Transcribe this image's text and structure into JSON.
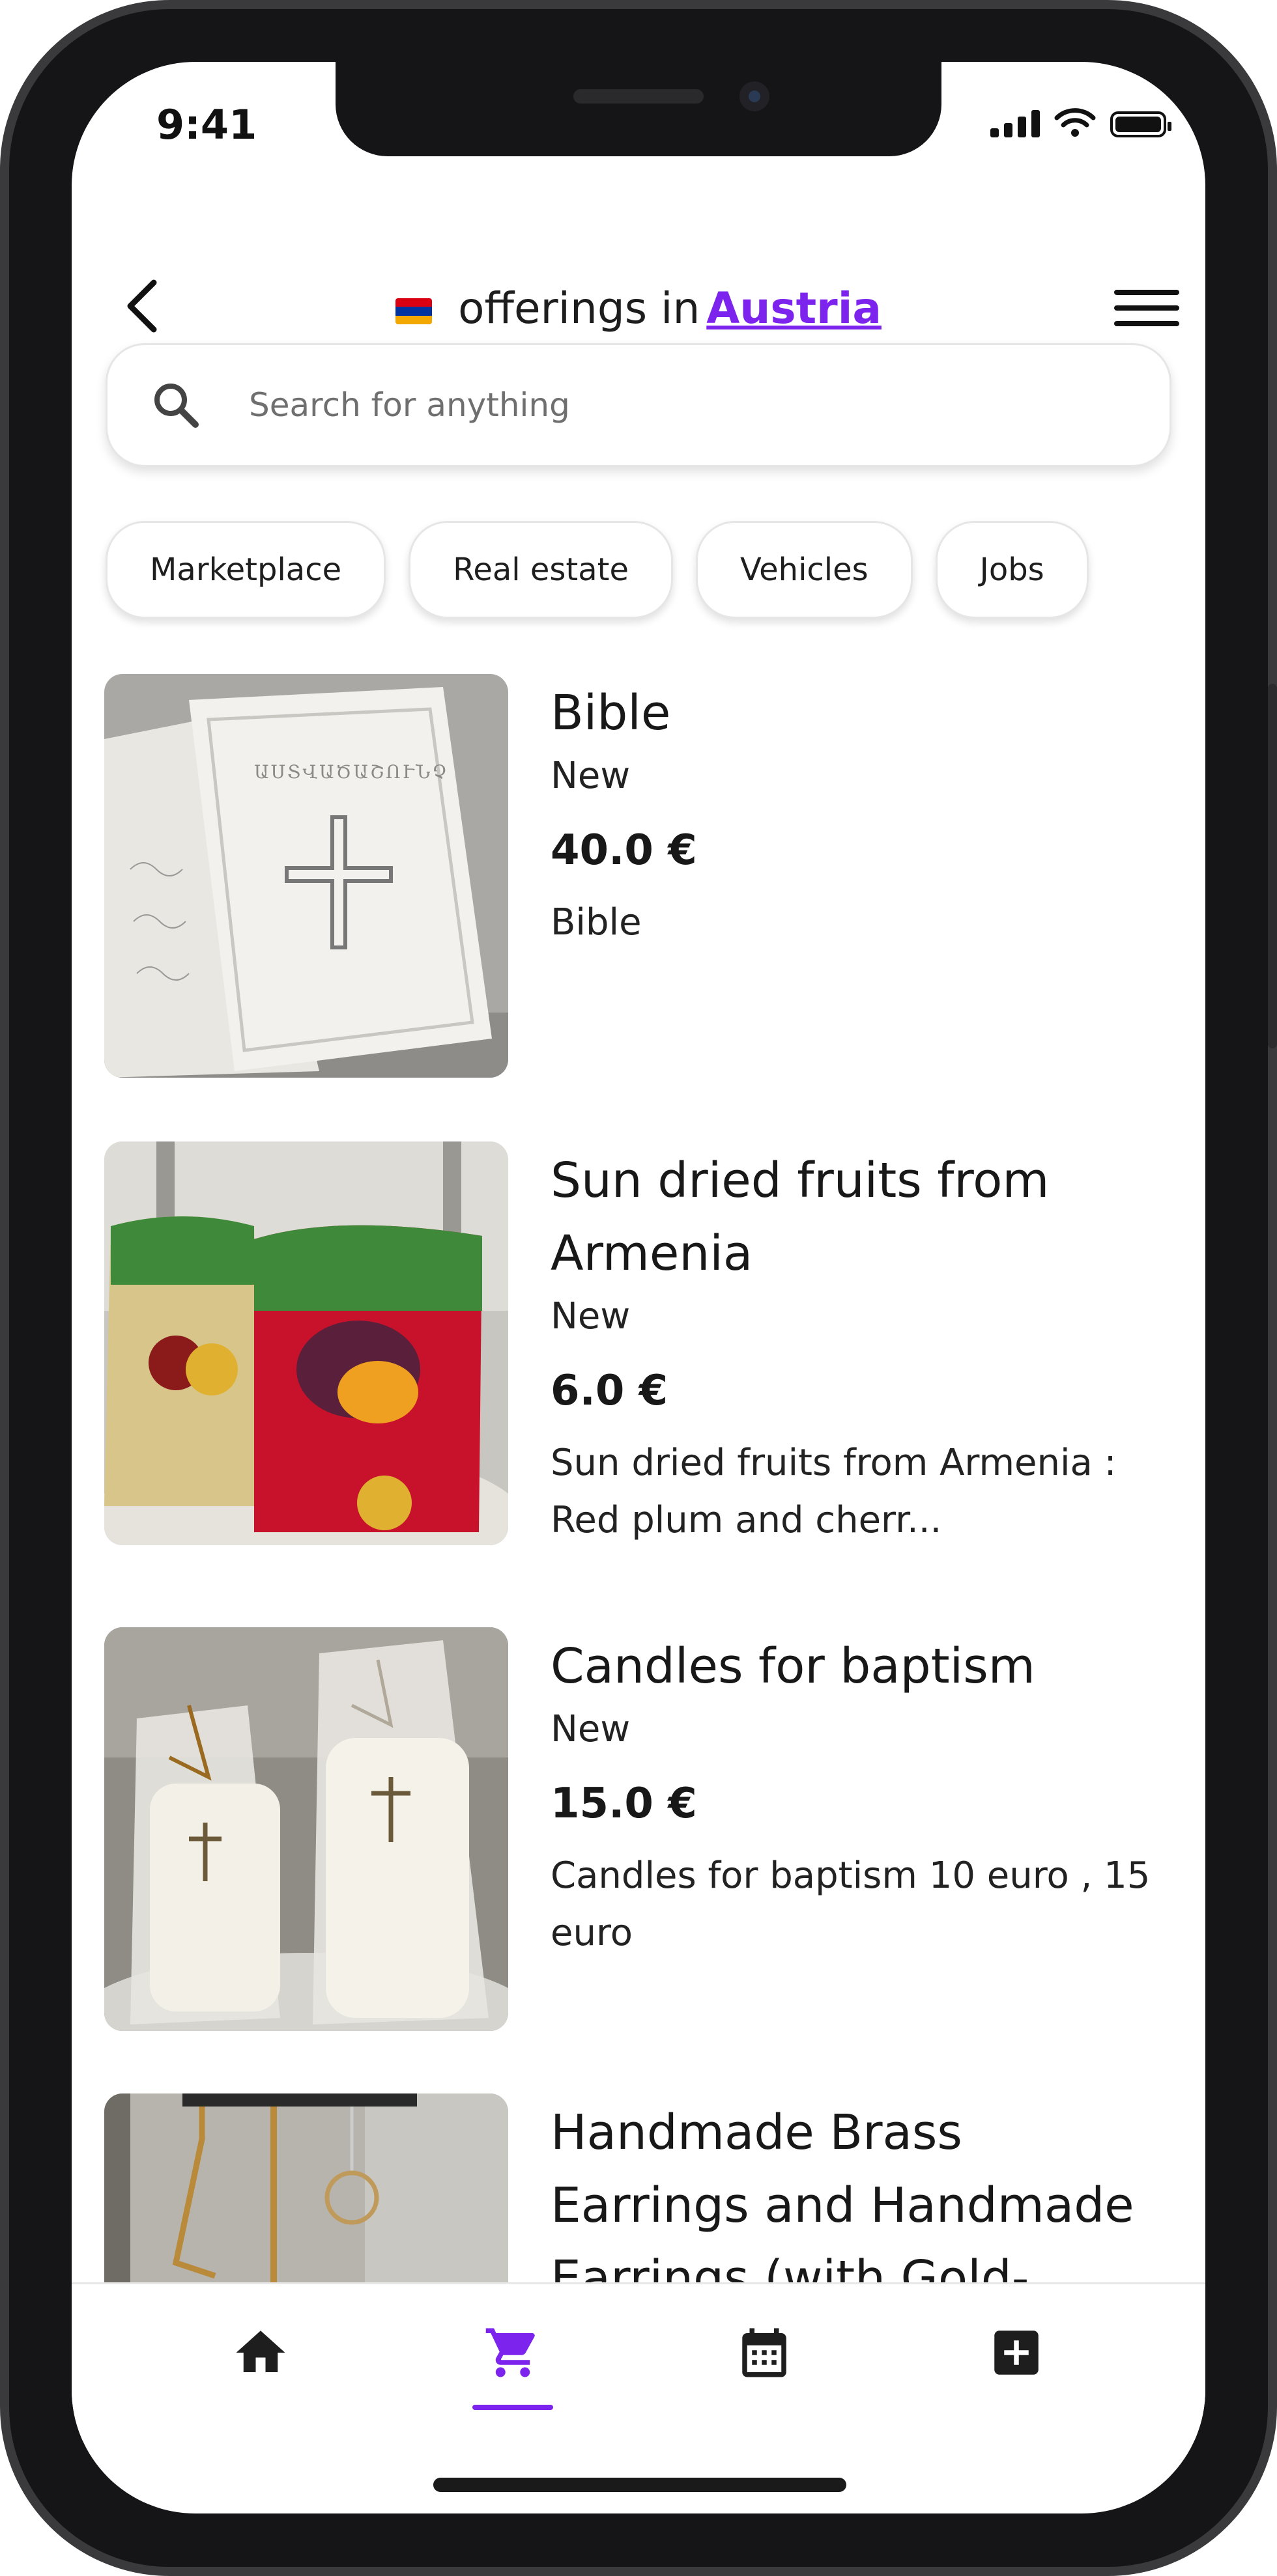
{
  "status": {
    "time": "9:41"
  },
  "header": {
    "title_prefix": "offerings in",
    "country": "Austria",
    "flag_colors": [
      "#d90012",
      "#0033a0",
      "#f2a800"
    ]
  },
  "search": {
    "placeholder": "Search for anything"
  },
  "categories": [
    {
      "label": "Marketplace"
    },
    {
      "label": "Real estate"
    },
    {
      "label": "Vehicles"
    },
    {
      "label": "Jobs"
    }
  ],
  "listings": [
    {
      "title": "Bible",
      "condition": "New",
      "price": "40.0 €",
      "description": "Bible"
    },
    {
      "title": "Sun dried fruits from Armenia",
      "condition": "New",
      "price": "6.0 €",
      "description": "Sun dried fruits from Armenia : Red plum and cherr..."
    },
    {
      "title": "Candles for baptism",
      "condition": "New",
      "price": "15.0 €",
      "description": "Candles for baptism 10 euro , 15 euro"
    },
    {
      "title": "Handmade Brass Earrings and Handmade Earrings (with Gold-"
    }
  ],
  "nav": {
    "items": [
      "home-icon",
      "cart-icon",
      "calendar-icon",
      "add-box-icon"
    ],
    "active": "cart-icon",
    "accent": "#7c23ee"
  }
}
